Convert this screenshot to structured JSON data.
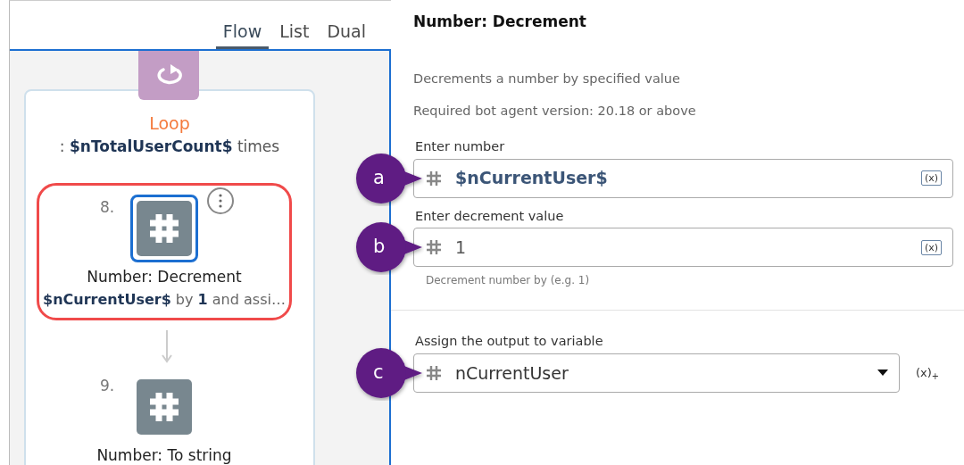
{
  "view_tabs": [
    {
      "label": "Flow",
      "selected": true
    },
    {
      "label": "List",
      "selected": false
    },
    {
      "label": "Dual",
      "selected": false
    }
  ],
  "flow": {
    "loop": {
      "title": "Loop",
      "description": ": **$nTotalUserCount$** times"
    },
    "steps": [
      {
        "number": "8.",
        "title": "Number: Decrement",
        "description": "**$nCurrentUser$** by **1** and assi…",
        "selected": true,
        "highlighted": true
      },
      {
        "number": "9.",
        "title": "Number: To string",
        "selected": false,
        "highlighted": false
      }
    ]
  },
  "properties": {
    "title": "Number: Decrement",
    "description": "Decrements a number by specified value",
    "version_note": "Required bot agent version: 20.18 or above",
    "fields": [
      {
        "kind": "input",
        "label": "Enter number",
        "value": "$nCurrentUser$",
        "is_variable": true,
        "variable_button": "(x)",
        "callout": "a"
      },
      {
        "kind": "input",
        "label": "Enter decrement value",
        "value": "1",
        "is_variable": false,
        "variable_button": "(x)",
        "hint": "Decrement number by (e.g. 1)",
        "callout": "b"
      }
    ],
    "output": {
      "kind": "select",
      "label": "Assign the output to variable",
      "value": "nCurrentUser",
      "add_variable_button": "(x)$_{+}$",
      "callout": "c"
    }
  }
}
